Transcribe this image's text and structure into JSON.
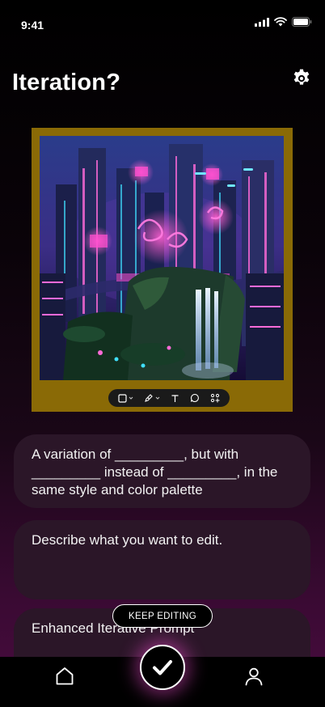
{
  "status_bar": {
    "time": "9:41"
  },
  "header": {
    "title": "Iteration?"
  },
  "icons": {
    "settings": "gear-icon",
    "home": "home-icon",
    "profile": "user-icon",
    "confirm": "checkmark-icon"
  },
  "toolbar": {
    "tools": [
      "rectangle-select",
      "pen",
      "text",
      "comment",
      "sparkle-grid"
    ]
  },
  "prompts": {
    "variation": "A variation of _________, but with _________ instead of _________, in the same style and color palette",
    "edit_placeholder": "Describe what you want to edit.",
    "enhanced": "Enhanced Iterative Prompt"
  },
  "actions": {
    "keep_editing": "KEEP EDITING"
  },
  "colors": {
    "frame": "#8a6a06",
    "card": "#2b1628",
    "accent_glow": "#ff50dc"
  }
}
